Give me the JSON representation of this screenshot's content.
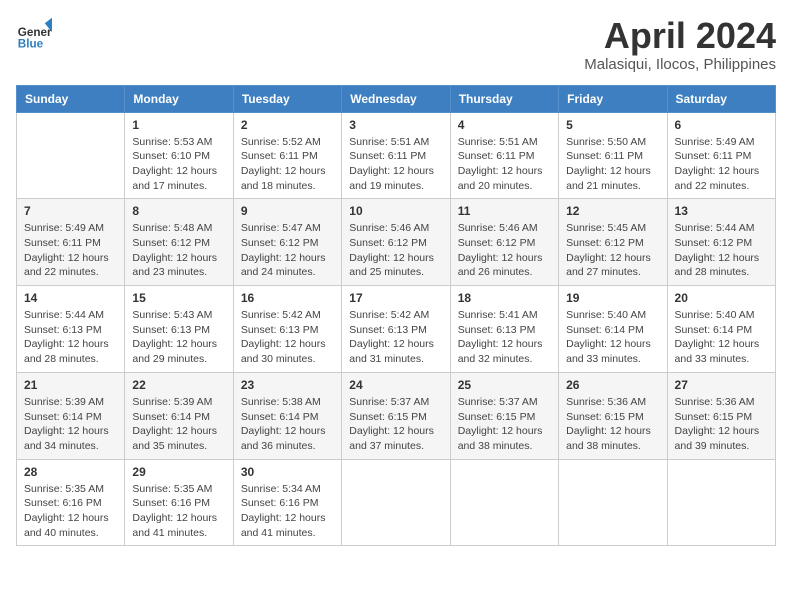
{
  "header": {
    "logo_line1": "General",
    "logo_line2": "Blue",
    "month_title": "April 2024",
    "location": "Malasiqui, Ilocos, Philippines"
  },
  "weekdays": [
    "Sunday",
    "Monday",
    "Tuesday",
    "Wednesday",
    "Thursday",
    "Friday",
    "Saturday"
  ],
  "weeks": [
    [
      {
        "day": "",
        "info": ""
      },
      {
        "day": "1",
        "info": "Sunrise: 5:53 AM\nSunset: 6:10 PM\nDaylight: 12 hours\nand 17 minutes."
      },
      {
        "day": "2",
        "info": "Sunrise: 5:52 AM\nSunset: 6:11 PM\nDaylight: 12 hours\nand 18 minutes."
      },
      {
        "day": "3",
        "info": "Sunrise: 5:51 AM\nSunset: 6:11 PM\nDaylight: 12 hours\nand 19 minutes."
      },
      {
        "day": "4",
        "info": "Sunrise: 5:51 AM\nSunset: 6:11 PM\nDaylight: 12 hours\nand 20 minutes."
      },
      {
        "day": "5",
        "info": "Sunrise: 5:50 AM\nSunset: 6:11 PM\nDaylight: 12 hours\nand 21 minutes."
      },
      {
        "day": "6",
        "info": "Sunrise: 5:49 AM\nSunset: 6:11 PM\nDaylight: 12 hours\nand 22 minutes."
      }
    ],
    [
      {
        "day": "7",
        "info": "Sunrise: 5:49 AM\nSunset: 6:11 PM\nDaylight: 12 hours\nand 22 minutes."
      },
      {
        "day": "8",
        "info": "Sunrise: 5:48 AM\nSunset: 6:12 PM\nDaylight: 12 hours\nand 23 minutes."
      },
      {
        "day": "9",
        "info": "Sunrise: 5:47 AM\nSunset: 6:12 PM\nDaylight: 12 hours\nand 24 minutes."
      },
      {
        "day": "10",
        "info": "Sunrise: 5:46 AM\nSunset: 6:12 PM\nDaylight: 12 hours\nand 25 minutes."
      },
      {
        "day": "11",
        "info": "Sunrise: 5:46 AM\nSunset: 6:12 PM\nDaylight: 12 hours\nand 26 minutes."
      },
      {
        "day": "12",
        "info": "Sunrise: 5:45 AM\nSunset: 6:12 PM\nDaylight: 12 hours\nand 27 minutes."
      },
      {
        "day": "13",
        "info": "Sunrise: 5:44 AM\nSunset: 6:12 PM\nDaylight: 12 hours\nand 28 minutes."
      }
    ],
    [
      {
        "day": "14",
        "info": "Sunrise: 5:44 AM\nSunset: 6:13 PM\nDaylight: 12 hours\nand 28 minutes."
      },
      {
        "day": "15",
        "info": "Sunrise: 5:43 AM\nSunset: 6:13 PM\nDaylight: 12 hours\nand 29 minutes."
      },
      {
        "day": "16",
        "info": "Sunrise: 5:42 AM\nSunset: 6:13 PM\nDaylight: 12 hours\nand 30 minutes."
      },
      {
        "day": "17",
        "info": "Sunrise: 5:42 AM\nSunset: 6:13 PM\nDaylight: 12 hours\nand 31 minutes."
      },
      {
        "day": "18",
        "info": "Sunrise: 5:41 AM\nSunset: 6:13 PM\nDaylight: 12 hours\nand 32 minutes."
      },
      {
        "day": "19",
        "info": "Sunrise: 5:40 AM\nSunset: 6:14 PM\nDaylight: 12 hours\nand 33 minutes."
      },
      {
        "day": "20",
        "info": "Sunrise: 5:40 AM\nSunset: 6:14 PM\nDaylight: 12 hours\nand 33 minutes."
      }
    ],
    [
      {
        "day": "21",
        "info": "Sunrise: 5:39 AM\nSunset: 6:14 PM\nDaylight: 12 hours\nand 34 minutes."
      },
      {
        "day": "22",
        "info": "Sunrise: 5:39 AM\nSunset: 6:14 PM\nDaylight: 12 hours\nand 35 minutes."
      },
      {
        "day": "23",
        "info": "Sunrise: 5:38 AM\nSunset: 6:14 PM\nDaylight: 12 hours\nand 36 minutes."
      },
      {
        "day": "24",
        "info": "Sunrise: 5:37 AM\nSunset: 6:15 PM\nDaylight: 12 hours\nand 37 minutes."
      },
      {
        "day": "25",
        "info": "Sunrise: 5:37 AM\nSunset: 6:15 PM\nDaylight: 12 hours\nand 38 minutes."
      },
      {
        "day": "26",
        "info": "Sunrise: 5:36 AM\nSunset: 6:15 PM\nDaylight: 12 hours\nand 38 minutes."
      },
      {
        "day": "27",
        "info": "Sunrise: 5:36 AM\nSunset: 6:15 PM\nDaylight: 12 hours\nand 39 minutes."
      }
    ],
    [
      {
        "day": "28",
        "info": "Sunrise: 5:35 AM\nSunset: 6:16 PM\nDaylight: 12 hours\nand 40 minutes."
      },
      {
        "day": "29",
        "info": "Sunrise: 5:35 AM\nSunset: 6:16 PM\nDaylight: 12 hours\nand 41 minutes."
      },
      {
        "day": "30",
        "info": "Sunrise: 5:34 AM\nSunset: 6:16 PM\nDaylight: 12 hours\nand 41 minutes."
      },
      {
        "day": "",
        "info": ""
      },
      {
        "day": "",
        "info": ""
      },
      {
        "day": "",
        "info": ""
      },
      {
        "day": "",
        "info": ""
      }
    ]
  ]
}
